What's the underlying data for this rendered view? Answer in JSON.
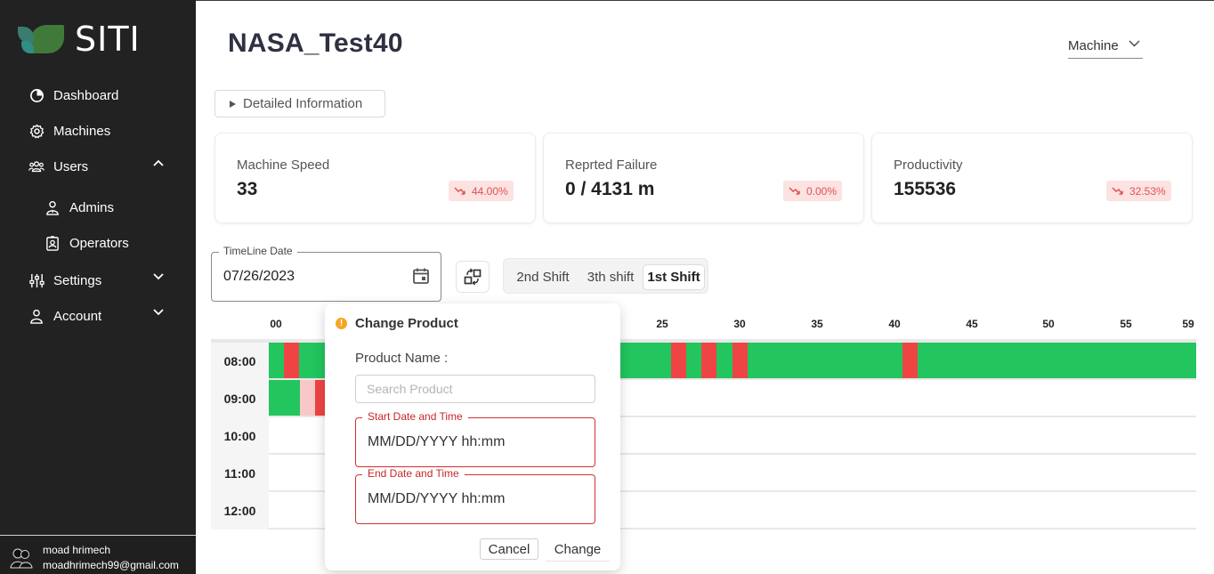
{
  "sidebar": {
    "logo_text": "SITI",
    "items": [
      {
        "label": "Dashboard",
        "icon": "dashboard-icon"
      },
      {
        "label": "Machines",
        "icon": "gear-icon"
      },
      {
        "label": "Users",
        "icon": "users-icon",
        "expanded": true
      },
      {
        "label": "Admins",
        "icon": "admin-icon"
      },
      {
        "label": "Operators",
        "icon": "badge-icon"
      },
      {
        "label": "Settings",
        "icon": "sliders-icon",
        "expanded": false
      },
      {
        "label": "Account",
        "icon": "person-icon",
        "expanded": false
      }
    ],
    "user": {
      "name": "moad hrimech",
      "email": "moadhrimech99@gmail.com"
    }
  },
  "header": {
    "title": "NASA_Test40",
    "machine_select": "Machine"
  },
  "details_button": "Detailed Information",
  "cards": [
    {
      "label": "Machine Speed",
      "value": "33",
      "change": "44.00%"
    },
    {
      "label": "Reprted Failure",
      "value": "0 / 4131 m",
      "change": "0.00%"
    },
    {
      "label": "Productivity",
      "value": "155536",
      "change": "32.53%"
    }
  ],
  "timeline_date": {
    "legend": "TimeLine Date",
    "value": "07/26/2023"
  },
  "shifts": {
    "items": [
      "2nd Shift",
      "3th shift",
      "1st Shift"
    ],
    "active": "1st Shift"
  },
  "timeline": {
    "ticks": [
      "00",
      "25",
      "30",
      "35",
      "40",
      "45",
      "50",
      "55",
      "59"
    ],
    "rows": [
      "08:00",
      "09:00",
      "10:00",
      "11:00",
      "12:00"
    ]
  },
  "colors": {
    "running": "#22c55e",
    "failure": "#ef4444",
    "minor": "#f8c8c8",
    "sidebar": "#222222",
    "danger": "#d32f2f"
  },
  "dialog": {
    "title": "Change Product",
    "product_label": "Product Name :",
    "search_placeholder": "Search Product",
    "start_legend": "Start Date and Time",
    "start_value": "MM/DD/YYYY hh:mm",
    "end_legend": "End Date and Time",
    "end_value": "MM/DD/YYYY hh:mm",
    "cancel": "Cancel",
    "change": "Change"
  }
}
